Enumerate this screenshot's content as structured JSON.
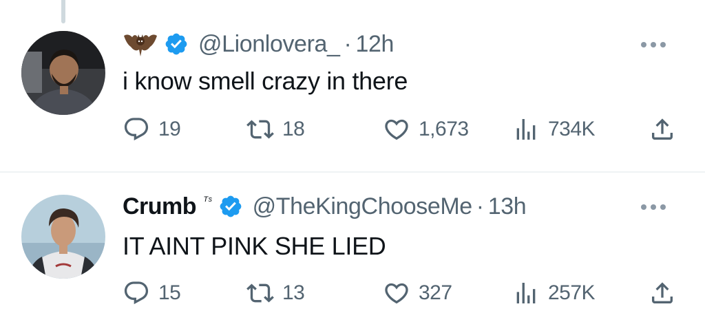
{
  "tweets": [
    {
      "display_name": "",
      "name_emoji": "bat-emoji",
      "verified": true,
      "handle": "@Lionlovera_",
      "separator": "·",
      "time": "12h",
      "text": "i know smell crazy in there",
      "replies": "19",
      "retweets": "18",
      "likes": "1,673",
      "views": "734K"
    },
    {
      "display_name": "Crumb",
      "name_suffix": "ᵀˢ",
      "verified": true,
      "handle": "@TheKingChooseMe",
      "separator": "·",
      "time": "13h",
      "text": "IT AINT PINK SHE LIED",
      "replies": "15",
      "retweets": "13",
      "likes": "327",
      "views": "257K"
    }
  ],
  "colors": {
    "text": "#0f1419",
    "secondary": "#536471",
    "verified": "#1d9bf0",
    "divider": "#eff3f4",
    "thread_line": "#cfd9de"
  },
  "icons": [
    "reply-icon",
    "retweet-icon",
    "like-icon",
    "views-icon",
    "share-icon",
    "more-icon",
    "verified-badge-icon"
  ]
}
